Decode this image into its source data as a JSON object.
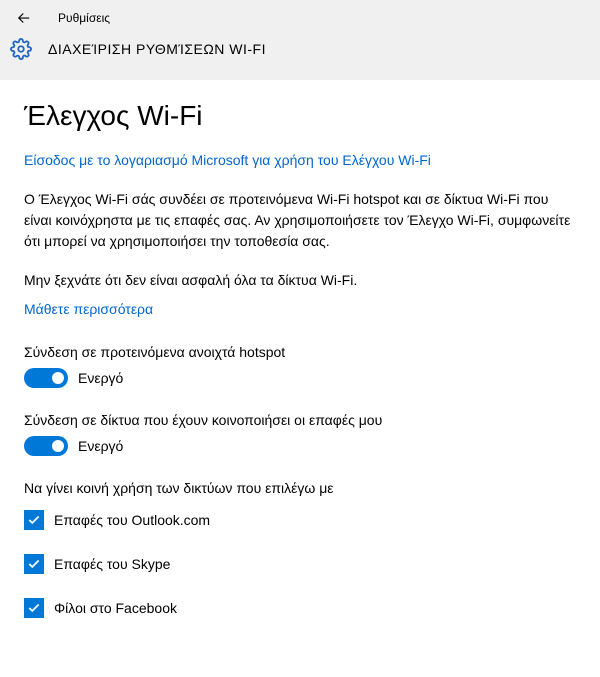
{
  "header": {
    "app_name": "Ρυθμίσεις",
    "page_name": "ΔΙΑΧΕΊΡΙΣΗ ΡΥΘΜΊΣΕΩΝ WI-FI"
  },
  "main": {
    "title": "Έλεγχος Wi-Fi",
    "signin_link": "Είσοδος με το λογαριασμό Microsoft για χρήση του Ελέγχου Wi-Fi",
    "description": "Ο Έλεγχος Wi-Fi σάς συνδέει σε προτεινόμενα Wi-Fi hotspot και σε δίκτυα Wi-Fi που είναι κοινόχρηστα με τις επαφές σας. Αν χρησιμοποιήσετε τον Έλεγχο Wi-Fi, συμφωνείτε ότι μπορεί να χρησιμοποιήσει την τοποθεσία σας.",
    "remember": "Μην ξεχνάτε ότι δεν είναι ασφαλή όλα τα δίκτυα Wi-Fi.",
    "learn_more": "Μάθετε περισσότερα",
    "toggle1": {
      "label": "Σύνδεση σε προτεινόμενα ανοιχτά hotspot",
      "state": "Ενεργό"
    },
    "toggle2": {
      "label": "Σύνδεση σε δίκτυα που έχουν κοινοποιήσει οι επαφές μου",
      "state": "Ενεργό"
    },
    "share_label": "Να γίνει κοινή χρήση των δικτύων που επιλέγω με",
    "checkboxes": [
      "Επαφές του Outlook.com",
      "Επαφές του Skype",
      "Φίλοι στο Facebook"
    ]
  }
}
